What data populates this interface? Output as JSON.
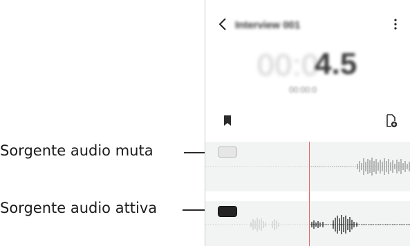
{
  "callouts": {
    "muted_source": "Sorgente audio muta",
    "active_source": "Sorgente audio attiva"
  },
  "app": {
    "title": "Interview 001",
    "timer_faded": "00:0",
    "timer_bold": "4.5",
    "timestamp": "00:00:0"
  },
  "icons": {
    "back": "chevron-left-icon",
    "more": "more-vertical-icon",
    "bookmark": "bookmark-icon",
    "add_file": "add-file-icon"
  },
  "colors": {
    "playhead": "#e86565",
    "track_background": "#f1f4f3",
    "muted_source": "#e6e6e6",
    "active_source": "#242424"
  },
  "tracks": [
    {
      "label": "Sorgente audio muta",
      "state": "muted"
    },
    {
      "label": "Sorgente audio attiva",
      "state": "active"
    }
  ]
}
